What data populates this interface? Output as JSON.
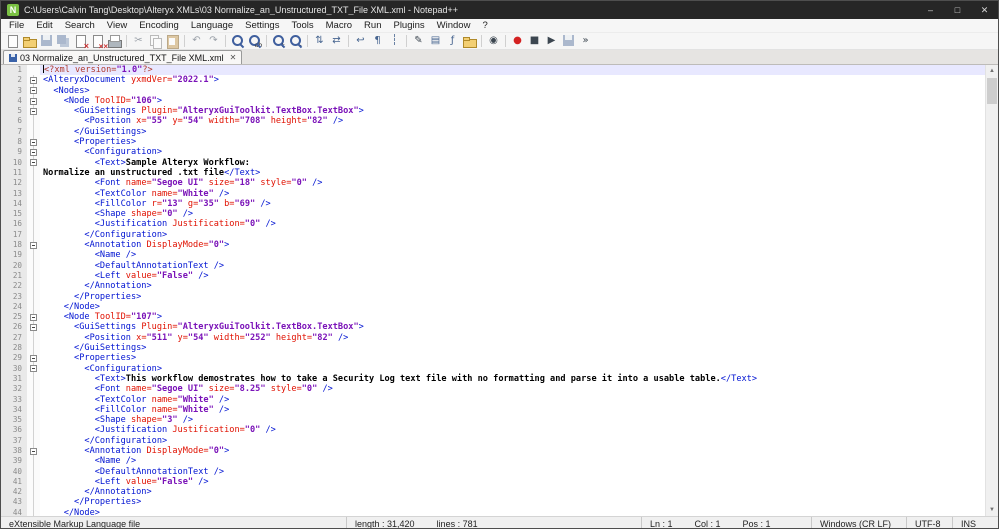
{
  "window": {
    "title": "C:\\Users\\Calvin Tang\\Desktop\\Alteryx XMLs\\03 Normalize_an_Unstructured_TXT_File XML.xml - Notepad++",
    "icon_letter": "N",
    "controls": {
      "minimize": "–",
      "maximize": "□",
      "close": "✕"
    }
  },
  "menu": {
    "items": [
      "File",
      "Edit",
      "Search",
      "View",
      "Encoding",
      "Language",
      "Settings",
      "Tools",
      "Macro",
      "Run",
      "Plugins",
      "Window",
      "?"
    ]
  },
  "toolbar": {
    "items": [
      {
        "name": "new-file",
        "cls": "page"
      },
      {
        "name": "open-file",
        "cls": "folder"
      },
      {
        "name": "save-file",
        "cls": "floppy dim"
      },
      {
        "name": "save-all",
        "cls": "floppy2 dim"
      },
      {
        "name": "close-file",
        "cls": "page xm"
      },
      {
        "name": "close-all",
        "cls": "page xm2"
      },
      {
        "name": "print",
        "cls": "printer"
      },
      {
        "type": "sep"
      },
      {
        "name": "cut",
        "ch": "✂",
        "color": "cGray"
      },
      {
        "name": "copy",
        "cls": "pages dim"
      },
      {
        "name": "paste",
        "cls": "clip dim"
      },
      {
        "type": "sep"
      },
      {
        "name": "undo",
        "ch": "↶",
        "color": "cGray"
      },
      {
        "name": "redo",
        "ch": "↷",
        "color": "cGray"
      },
      {
        "type": "sep"
      },
      {
        "name": "find",
        "cls": "mag"
      },
      {
        "name": "replace",
        "cls": "mag",
        "ch": "ab"
      },
      {
        "type": "sep"
      },
      {
        "name": "zoom-in",
        "cls": "mag",
        "ch": "+"
      },
      {
        "name": "zoom-out",
        "cls": "mag",
        "ch": "−"
      },
      {
        "type": "sep"
      },
      {
        "name": "sync-vertical",
        "ch": "⇅",
        "color": "cBlue"
      },
      {
        "name": "sync-horizontal",
        "ch": "⇄",
        "color": "cBlue"
      },
      {
        "type": "sep"
      },
      {
        "name": "word-wrap",
        "ch": "↩",
        "color": "cBlue"
      },
      {
        "name": "show-all-characters",
        "ch": "¶",
        "color": "cBlue"
      },
      {
        "name": "indent-guide",
        "ch": "┆",
        "color": "cBlue"
      },
      {
        "type": "sep"
      },
      {
        "name": "define-language",
        "ch": "✎",
        "color": "cDark"
      },
      {
        "name": "document-map",
        "ch": "▤",
        "color": "cBlue"
      },
      {
        "name": "function-list",
        "ch": "ƒ",
        "color": "cBlue"
      },
      {
        "name": "folder-as-workspace",
        "cls": "folder"
      },
      {
        "type": "sep"
      },
      {
        "name": "monitoring",
        "ch": "◉",
        "color": "cDark"
      },
      {
        "type": "sep"
      },
      {
        "name": "record-macro",
        "ch": "●",
        "color": "cRed"
      },
      {
        "name": "stop-macro",
        "ch": "■",
        "color": "cDark"
      },
      {
        "name": "play-macro",
        "ch": "▶",
        "color": "cDark"
      },
      {
        "name": "save-macro",
        "cls": "floppy dim"
      },
      {
        "name": "run-macro-multiple",
        "ch": "»",
        "color": "cDark"
      }
    ]
  },
  "tabbar": {
    "close_glyph": "✕",
    "tabs": [
      {
        "label": "03 Normalize_an_Unstructured_TXT_File XML.xml",
        "active": true,
        "saved": true
      }
    ]
  },
  "colors": {
    "syntax": {
      "tag": "#0013d2",
      "attr": "#e01000",
      "value": "#7a12b8",
      "text": "#000000",
      "decl": "#b03a2e"
    },
    "brand_green": "#7ac143"
  },
  "editor": {
    "cursor": {
      "line": 1,
      "col": 1
    },
    "lines": [
      {
        "n": 1,
        "f": "",
        "s": [
          [
            "d",
            "<?xml version="
          ],
          [
            "v",
            "\"1.0\""
          ],
          [
            "d",
            "?>"
          ]
        ]
      },
      {
        "n": 2,
        "f": "b",
        "s": [
          [
            "t",
            "<AlteryxDocument "
          ],
          [
            "a",
            "yxmdVer="
          ],
          [
            "v",
            "\"2022.1\""
          ],
          [
            "t",
            ">"
          ]
        ]
      },
      {
        "n": 3,
        "f": "b",
        "s": [
          [
            "t",
            "  <Nodes>"
          ]
        ]
      },
      {
        "n": 4,
        "f": "b",
        "s": [
          [
            "t",
            "    <Node "
          ],
          [
            "a",
            "ToolID="
          ],
          [
            "v",
            "\"106\""
          ],
          [
            "t",
            ">"
          ]
        ]
      },
      {
        "n": 5,
        "f": "b",
        "s": [
          [
            "t",
            "      <GuiSettings "
          ],
          [
            "a",
            "Plugin="
          ],
          [
            "v",
            "\"AlteryxGuiToolkit.TextBox.TextBox\""
          ],
          [
            "t",
            ">"
          ]
        ]
      },
      {
        "n": 6,
        "f": "l",
        "s": [
          [
            "t",
            "        <Position "
          ],
          [
            "a",
            "x="
          ],
          [
            "v",
            "\"55\""
          ],
          [
            "a",
            " y="
          ],
          [
            "v",
            "\"54\""
          ],
          [
            "a",
            " width="
          ],
          [
            "v",
            "\"708\""
          ],
          [
            "a",
            " height="
          ],
          [
            "v",
            "\"82\""
          ],
          [
            "t",
            " />"
          ]
        ]
      },
      {
        "n": 7,
        "f": "l",
        "s": [
          [
            "t",
            "      </GuiSettings>"
          ]
        ]
      },
      {
        "n": 8,
        "f": "b",
        "s": [
          [
            "t",
            "      <Properties>"
          ]
        ]
      },
      {
        "n": 9,
        "f": "b",
        "s": [
          [
            "t",
            "        <Configuration>"
          ]
        ]
      },
      {
        "n": 10,
        "f": "b",
        "s": [
          [
            "t",
            "          <Text>"
          ],
          [
            "x",
            "Sample Alteryx Workflow:"
          ]
        ]
      },
      {
        "n": 11,
        "f": "l",
        "s": [
          [
            "x",
            "Normalize an unstructured .txt file"
          ],
          [
            "t",
            "</Text>"
          ]
        ]
      },
      {
        "n": 12,
        "f": "l",
        "s": [
          [
            "t",
            "          <Font "
          ],
          [
            "a",
            "name="
          ],
          [
            "v",
            "\"Segoe UI\""
          ],
          [
            "a",
            " size="
          ],
          [
            "v",
            "\"18\""
          ],
          [
            "a",
            " style="
          ],
          [
            "v",
            "\"0\""
          ],
          [
            "t",
            " />"
          ]
        ]
      },
      {
        "n": 13,
        "f": "l",
        "s": [
          [
            "t",
            "          <TextColor "
          ],
          [
            "a",
            "name="
          ],
          [
            "v",
            "\"White\""
          ],
          [
            "t",
            " />"
          ]
        ]
      },
      {
        "n": 14,
        "f": "l",
        "s": [
          [
            "t",
            "          <FillColor "
          ],
          [
            "a",
            "r="
          ],
          [
            "v",
            "\"13\""
          ],
          [
            "a",
            " g="
          ],
          [
            "v",
            "\"35\""
          ],
          [
            "a",
            " b="
          ],
          [
            "v",
            "\"69\""
          ],
          [
            "t",
            " />"
          ]
        ]
      },
      {
        "n": 15,
        "f": "l",
        "s": [
          [
            "t",
            "          <Shape "
          ],
          [
            "a",
            "shape="
          ],
          [
            "v",
            "\"0\""
          ],
          [
            "t",
            " />"
          ]
        ]
      },
      {
        "n": 16,
        "f": "l",
        "s": [
          [
            "t",
            "          <Justification "
          ],
          [
            "a",
            "Justification="
          ],
          [
            "v",
            "\"0\""
          ],
          [
            "t",
            " />"
          ]
        ]
      },
      {
        "n": 17,
        "f": "l",
        "s": [
          [
            "t",
            "        </Configuration>"
          ]
        ]
      },
      {
        "n": 18,
        "f": "b",
        "s": [
          [
            "t",
            "        <Annotation "
          ],
          [
            "a",
            "DisplayMode="
          ],
          [
            "v",
            "\"0\""
          ],
          [
            "t",
            ">"
          ]
        ]
      },
      {
        "n": 19,
        "f": "l",
        "s": [
          [
            "t",
            "          <Name />"
          ]
        ]
      },
      {
        "n": 20,
        "f": "l",
        "s": [
          [
            "t",
            "          <DefaultAnnotationText />"
          ]
        ]
      },
      {
        "n": 21,
        "f": "l",
        "s": [
          [
            "t",
            "          <Left "
          ],
          [
            "a",
            "value="
          ],
          [
            "v",
            "\"False\""
          ],
          [
            "t",
            " />"
          ]
        ]
      },
      {
        "n": 22,
        "f": "l",
        "s": [
          [
            "t",
            "        </Annotation>"
          ]
        ]
      },
      {
        "n": 23,
        "f": "l",
        "s": [
          [
            "t",
            "      </Properties>"
          ]
        ]
      },
      {
        "n": 24,
        "f": "l",
        "s": [
          [
            "t",
            "    </Node>"
          ]
        ]
      },
      {
        "n": 25,
        "f": "b",
        "s": [
          [
            "t",
            "    <Node "
          ],
          [
            "a",
            "ToolID="
          ],
          [
            "v",
            "\"107\""
          ],
          [
            "t",
            ">"
          ]
        ]
      },
      {
        "n": 26,
        "f": "b",
        "s": [
          [
            "t",
            "      <GuiSettings "
          ],
          [
            "a",
            "Plugin="
          ],
          [
            "v",
            "\"AlteryxGuiToolkit.TextBox.TextBox\""
          ],
          [
            "t",
            ">"
          ]
        ]
      },
      {
        "n": 27,
        "f": "l",
        "s": [
          [
            "t",
            "        <Position "
          ],
          [
            "a",
            "x="
          ],
          [
            "v",
            "\"511\""
          ],
          [
            "a",
            " y="
          ],
          [
            "v",
            "\"54\""
          ],
          [
            "a",
            " width="
          ],
          [
            "v",
            "\"252\""
          ],
          [
            "a",
            " height="
          ],
          [
            "v",
            "\"82\""
          ],
          [
            "t",
            " />"
          ]
        ]
      },
      {
        "n": 28,
        "f": "l",
        "s": [
          [
            "t",
            "      </GuiSettings>"
          ]
        ]
      },
      {
        "n": 29,
        "f": "b",
        "s": [
          [
            "t",
            "      <Properties>"
          ]
        ]
      },
      {
        "n": 30,
        "f": "b",
        "s": [
          [
            "t",
            "        <Configuration>"
          ]
        ]
      },
      {
        "n": 31,
        "f": "l",
        "s": [
          [
            "t",
            "          <Text>"
          ],
          [
            "x",
            "This workflow demostrates how to take a Security Log text file with no formatting and parse it into a usable table."
          ],
          [
            "t",
            "</Text>"
          ]
        ]
      },
      {
        "n": 32,
        "f": "l",
        "s": [
          [
            "t",
            "          <Font "
          ],
          [
            "a",
            "name="
          ],
          [
            "v",
            "\"Segoe UI\""
          ],
          [
            "a",
            " size="
          ],
          [
            "v",
            "\"8.25\""
          ],
          [
            "a",
            " style="
          ],
          [
            "v",
            "\"0\""
          ],
          [
            "t",
            " />"
          ]
        ]
      },
      {
        "n": 33,
        "f": "l",
        "s": [
          [
            "t",
            "          <TextColor "
          ],
          [
            "a",
            "name="
          ],
          [
            "v",
            "\"White\""
          ],
          [
            "t",
            " />"
          ]
        ]
      },
      {
        "n": 34,
        "f": "l",
        "s": [
          [
            "t",
            "          <FillColor "
          ],
          [
            "a",
            "name="
          ],
          [
            "v",
            "\"White\""
          ],
          [
            "t",
            " />"
          ]
        ]
      },
      {
        "n": 35,
        "f": "l",
        "s": [
          [
            "t",
            "          <Shape "
          ],
          [
            "a",
            "shape="
          ],
          [
            "v",
            "\"3\""
          ],
          [
            "t",
            " />"
          ]
        ]
      },
      {
        "n": 36,
        "f": "l",
        "s": [
          [
            "t",
            "          <Justification "
          ],
          [
            "a",
            "Justification="
          ],
          [
            "v",
            "\"0\""
          ],
          [
            "t",
            " />"
          ]
        ]
      },
      {
        "n": 37,
        "f": "l",
        "s": [
          [
            "t",
            "        </Configuration>"
          ]
        ]
      },
      {
        "n": 38,
        "f": "b",
        "s": [
          [
            "t",
            "        <Annotation "
          ],
          [
            "a",
            "DisplayMode="
          ],
          [
            "v",
            "\"0\""
          ],
          [
            "t",
            ">"
          ]
        ]
      },
      {
        "n": 39,
        "f": "l",
        "s": [
          [
            "t",
            "          <Name />"
          ]
        ]
      },
      {
        "n": 40,
        "f": "l",
        "s": [
          [
            "t",
            "          <DefaultAnnotationText />"
          ]
        ]
      },
      {
        "n": 41,
        "f": "l",
        "s": [
          [
            "t",
            "          <Left "
          ],
          [
            "a",
            "value="
          ],
          [
            "v",
            "\"False\""
          ],
          [
            "t",
            " />"
          ]
        ]
      },
      {
        "n": 42,
        "f": "l",
        "s": [
          [
            "t",
            "        </Annotation>"
          ]
        ]
      },
      {
        "n": 43,
        "f": "l",
        "s": [
          [
            "t",
            "      </Properties>"
          ]
        ]
      },
      {
        "n": 44,
        "f": "l",
        "s": [
          [
            "t",
            "    </Node>"
          ]
        ]
      }
    ]
  },
  "scrollbar": {
    "up": "▲",
    "down": "▼"
  },
  "statusbar": {
    "doctype": "eXtensible Markup Language file",
    "length": "length : 31,420",
    "lines": "lines : 781",
    "line": "Ln : 1",
    "column": "Col : 1",
    "position": "Pos : 1",
    "eol": "Windows (CR LF)",
    "encoding": "UTF-8",
    "mode": "INS"
  }
}
